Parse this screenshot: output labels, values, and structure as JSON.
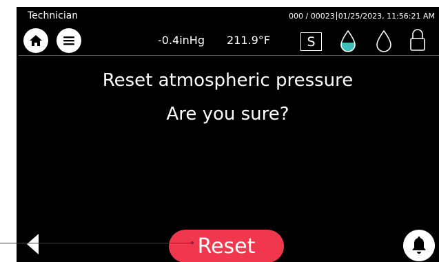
{
  "header": {
    "role": "Technician",
    "counter": "000 / 00023",
    "datetime": "01/25/2023, 11:56:21 AM"
  },
  "status": {
    "vacuum": "-0.4inHg",
    "temperature": "211.9°F",
    "mode_letter": "S",
    "icons": [
      "home-icon",
      "menu-icon",
      "water-drop-filled-icon",
      "water-drop-empty-icon",
      "lock-open-icon"
    ]
  },
  "dialog": {
    "line1": "Reset atmospheric pressure",
    "line2": "Are you sure?"
  },
  "footer": {
    "reset_label": "Reset",
    "icons": [
      "back-arrow-icon",
      "bell-icon"
    ]
  },
  "colors": {
    "screen_bg": "#000000",
    "text": "#ffffff",
    "reset_button": "#f0374e",
    "water_fill": "#3fbfb8",
    "pointer": "#8a1a40"
  }
}
